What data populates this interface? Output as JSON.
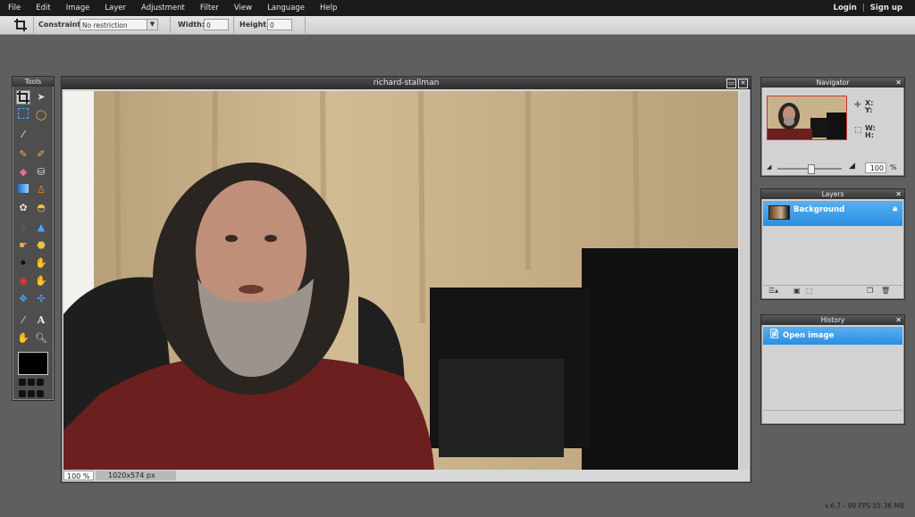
{
  "menu": [
    "File",
    "Edit",
    "Image",
    "Layer",
    "Adjustment",
    "Filter",
    "View",
    "Language",
    "Help"
  ],
  "auth": {
    "login": "Login",
    "separator": "|",
    "signup": "Sign up"
  },
  "options": {
    "constraint_label": "Constraint:",
    "constraint_value": "No restriction",
    "width_label": "Width:",
    "width_value": "0",
    "height_label": "Height:",
    "height_value": "0"
  },
  "tools_panel": {
    "title": "Tools"
  },
  "document": {
    "title": "richard-stallman",
    "zoom": "100 %",
    "dimensions": "1020x574 px"
  },
  "navigator": {
    "title": "Navigator",
    "x_label": "X:",
    "y_label": "Y:",
    "w_label": "W:",
    "h_label": "H:",
    "zoom_value": "100",
    "zoom_unit": "%"
  },
  "layers": {
    "title": "Layers",
    "items": [
      "Background"
    ]
  },
  "history": {
    "title": "History",
    "items": [
      "Open image"
    ]
  },
  "status": {
    "version": "v.6.7 - 99 FPS 55.36 MB"
  },
  "colors": {
    "selection": "#2a8ee0",
    "menubar": "#1b1b1b",
    "workspace": "#5f5f5f",
    "foreground": "#000000"
  }
}
